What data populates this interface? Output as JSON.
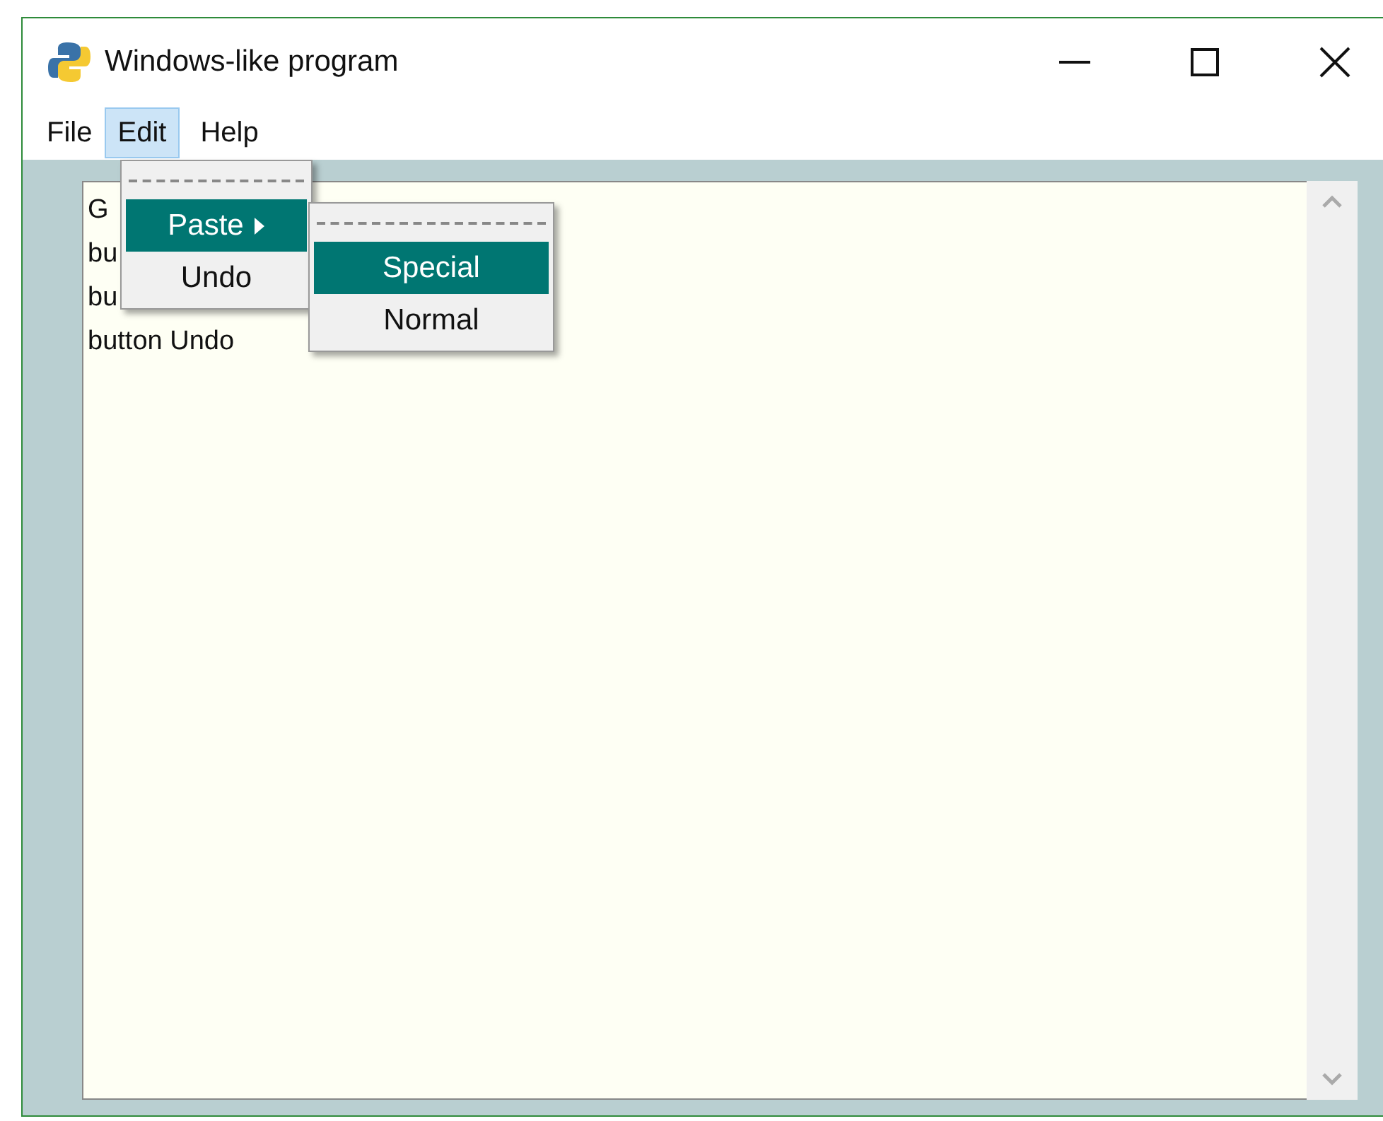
{
  "window": {
    "title": "Windows-like program"
  },
  "menu": [
    {
      "label": "File",
      "selected": false
    },
    {
      "label": "Edit",
      "selected": true
    },
    {
      "label": "Help",
      "selected": false
    }
  ],
  "dropdown": [
    {
      "kind": "tearoff"
    },
    {
      "kind": "cascade",
      "label": "Paste",
      "selected": true
    },
    {
      "kind": "command",
      "label": "Undo",
      "selected": false
    }
  ],
  "submenu": [
    {
      "kind": "tearoff"
    },
    {
      "kind": "command",
      "label": "Special",
      "selected": true
    },
    {
      "kind": "command",
      "label": "Normal",
      "selected": false
    }
  ],
  "text_lines": [
    "G",
    "bu",
    "bu",
    "button Undo"
  ]
}
